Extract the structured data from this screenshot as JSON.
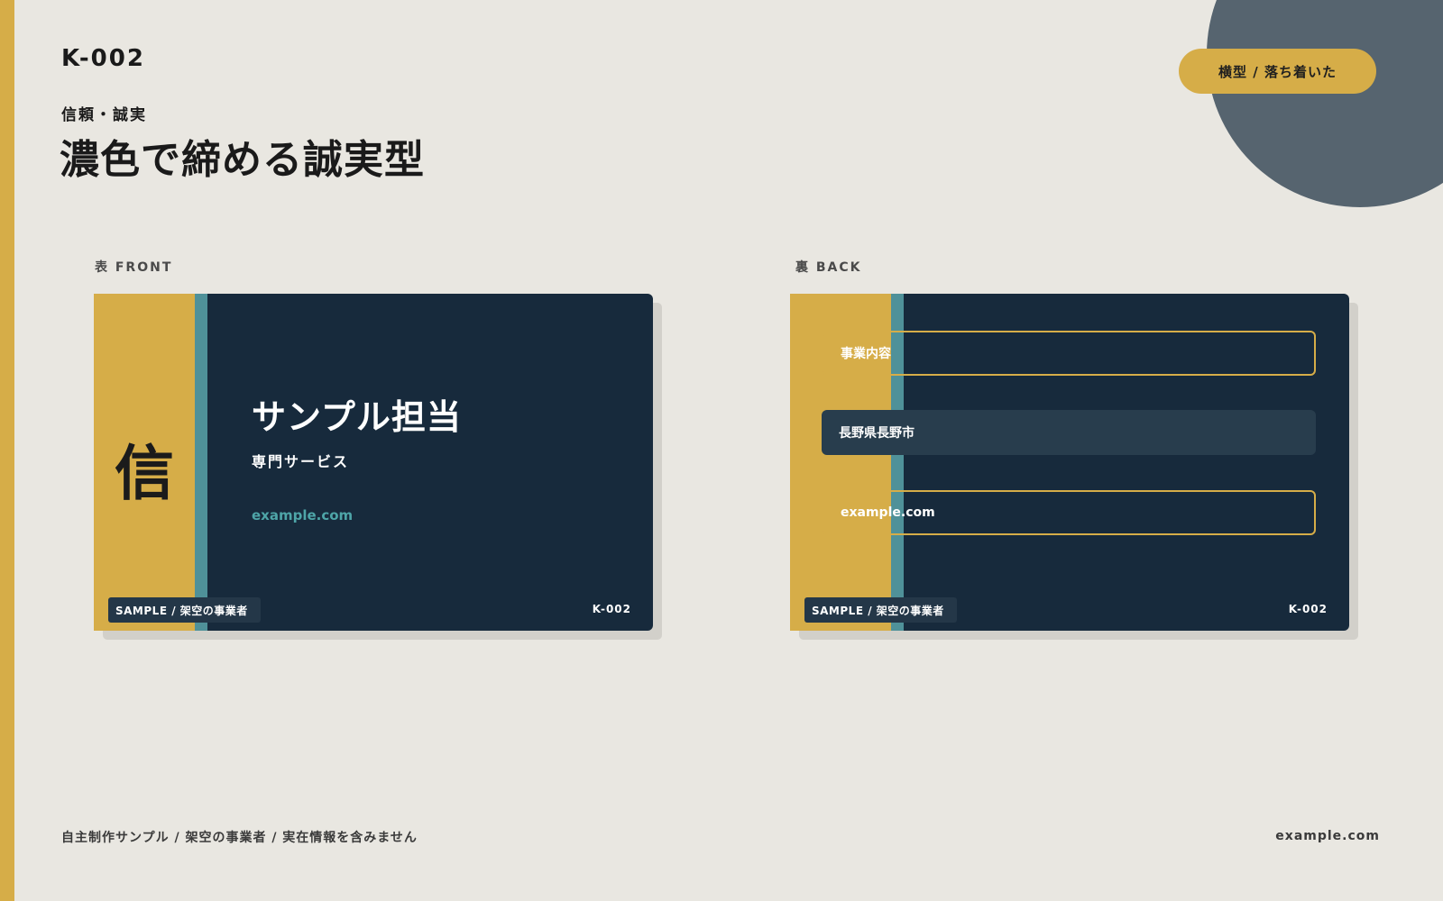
{
  "header": {
    "code": "K-002",
    "category": "信頼・誠実",
    "title": "濃色で締める誠実型",
    "tag": "横型 / 落ち着いた"
  },
  "front": {
    "label": "表 FRONT",
    "kanji": "信",
    "name": "サンプル担当",
    "service": "専門サービス",
    "url": "example.com",
    "sample_badge": "SAMPLE / 架空の事業者",
    "code": "K-002"
  },
  "back": {
    "label": "裏 BACK",
    "business": "事業内容",
    "address": "長野県長野市",
    "url": "example.com",
    "sample_badge": "SAMPLE / 架空の事業者",
    "code": "K-002"
  },
  "footer": {
    "note": "自主制作サンプル / 架空の事業者 / 実在情報を含みません",
    "url": "example.com"
  },
  "colors": {
    "background": "#e9e7e1",
    "accent_gold": "#d6ad48",
    "card_navy": "#172a3c",
    "teal": "#4f9199",
    "corner_circle": "#56646f"
  }
}
